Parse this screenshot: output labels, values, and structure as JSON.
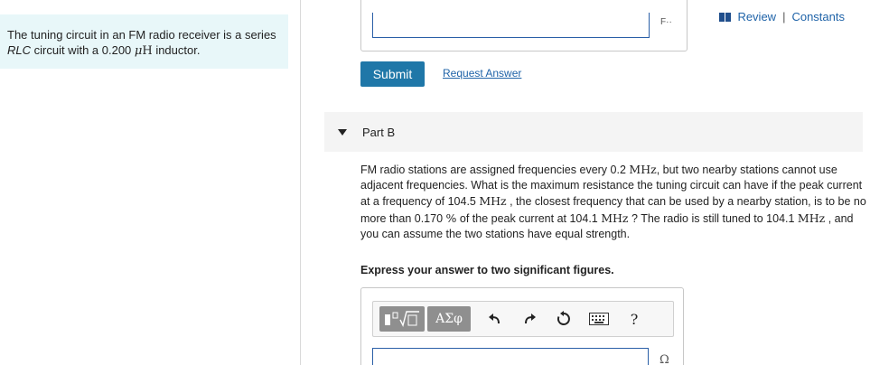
{
  "intro": {
    "text_before": "The tuning circuit in an FM radio receiver is a series ",
    "circuit": "RLC",
    "text_middle": " circuit with a 0.200 ",
    "unit_mu": "μ",
    "unit_h": "H",
    "text_after": " inductor."
  },
  "toplinks": {
    "review": "Review",
    "separator": "|",
    "constants": "Constants"
  },
  "partA": {
    "unit_glyph": "F··"
  },
  "actions": {
    "submit": "Submit",
    "request": "Request Answer"
  },
  "partB": {
    "label": "Part B",
    "q1": "FM radio stations are assigned frequencies every 0.2 ",
    "mhz": "MHz",
    "q2": ", but two nearby stations cannot use adjacent frequencies. What is the maximum resistance the tuning circuit can have if the peak current at a frequency of 104.5 ",
    "q3": " , the closest frequency that can be used by a nearby station, is to be no more than 0.170 ",
    "pct": "%",
    "q4": " of the peak current at 104.1 ",
    "q5": " ? The radio is still tuned to 104.1 ",
    "q6": " , and you can assume the two stations have equal strength.",
    "instruction": "Express your answer to two significant figures.",
    "greek": "ΑΣφ",
    "help": "?",
    "unit": "Ω"
  },
  "colors": {
    "accent": "#1f77a8",
    "link": "#1f63a8",
    "intro_bg": "#e8f7f9"
  },
  "icons": [
    "templates-icon",
    "greek-letters-icon",
    "undo-icon",
    "redo-icon",
    "reset-icon",
    "keyboard-icon",
    "help-icon"
  ]
}
